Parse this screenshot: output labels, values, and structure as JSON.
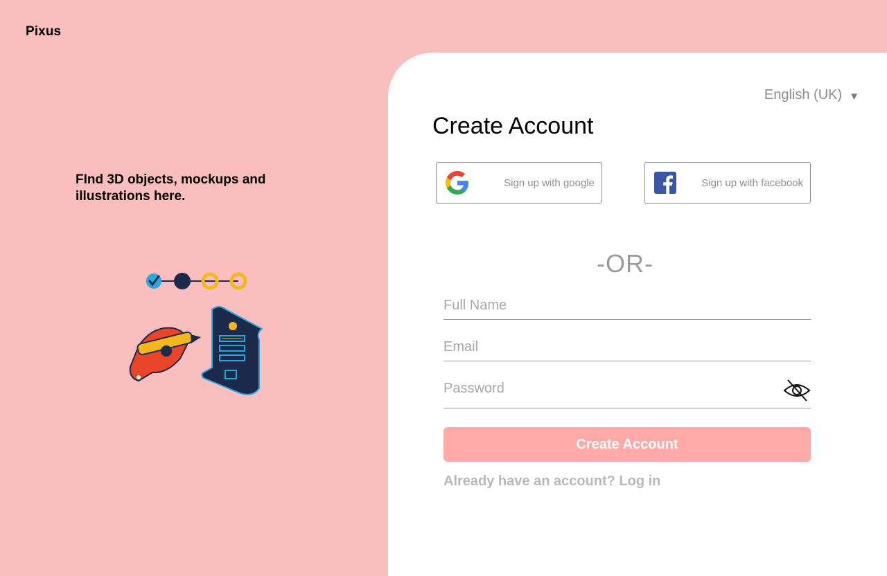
{
  "brand": {
    "name": "Pixus"
  },
  "hero": {
    "tagline": "FInd 3D objects, mockups and illustrations here."
  },
  "language": {
    "selected": "English (UK)",
    "caret": "▼"
  },
  "form": {
    "title": "Create Account",
    "social": {
      "google_label": "Sign up with google",
      "facebook_label": "Sign up with facebook"
    },
    "divider": "-OR-",
    "fields": {
      "full_name_placeholder": "Full Name",
      "email_placeholder": "Email",
      "password_placeholder": "Password"
    },
    "submit_label": "Create Account",
    "login_link": "Already have an account? Log in"
  },
  "colors": {
    "background": "#f9bebd",
    "card": "#ffffff",
    "cta": "#ffaaa8",
    "muted_text": "#8e8e8e",
    "facebook_blue": "#3b57a4"
  },
  "icons": [
    "google-icon",
    "facebook-icon",
    "eye-slash-icon",
    "progress-steps-illustration",
    "hand-pencil-illustration",
    "document-scroll-illustration"
  ]
}
